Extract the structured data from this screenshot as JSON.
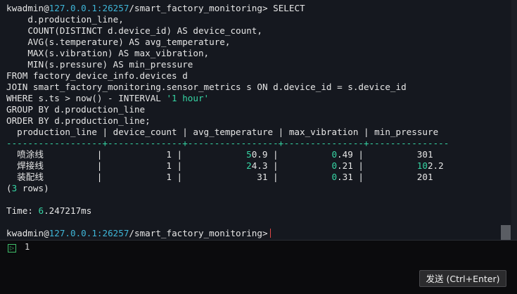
{
  "prompt": {
    "user": "kwadmin",
    "at": "@",
    "host": "127.0.0.1:26257",
    "db": "/smart_factory_monitoring",
    "symbol": ">"
  },
  "query_lines": [
    " SELECT",
    "    d.production_line,",
    "    COUNT(DISTINCT d.device_id) AS device_count,",
    "    AVG(s.temperature) AS avg_temperature,",
    "    MAX(s.vibration) AS max_vibration,",
    "    MIN(s.pressure) AS min_pressure",
    "FROM factory_device_info.devices d",
    "JOIN smart_factory_monitoring.sensor_metrics s ON d.device_id = s.device_id",
    "WHERE s.ts > now() - INTERVAL ",
    "GROUP BY d.production_line",
    "ORDER BY d.production_line;"
  ],
  "interval_literal": "'1 hour'",
  "result_table": {
    "header": "  production_line | device_count | avg_temperature | max_vibration | min_pressure",
    "separator": "------------------+--------------+-----------------+---------------+---------------",
    "rows": [
      {
        "name": "喷涂线",
        "device_count": "1",
        "avg_temperature_hl": "5",
        "avg_temperature_rest": "0.9",
        "max_vibration_hl": "0",
        "max_vibration_rest": ".49",
        "min_pressure": "301"
      },
      {
        "name": "焊接线",
        "device_count": "1",
        "avg_temperature_hl": "2",
        "avg_temperature_rest": "4.3",
        "max_vibration_hl": "0",
        "max_vibration_rest": ".21",
        "min_pressure_hl": "10",
        "min_pressure_rest": "2.2"
      },
      {
        "name": "装配线",
        "device_count": "1",
        "avg_temperature": "31",
        "max_vibration_hl": "0",
        "max_vibration_rest": ".31",
        "min_pressure": "201"
      }
    ]
  },
  "row_count": {
    "open": "(",
    "num": "3",
    "rest": " rows)"
  },
  "timing": {
    "label": "Time: ",
    "value": "6",
    "rest": ".247217ms"
  },
  "input_panel": {
    "line_number": "1",
    "icon": "line-number-icon"
  },
  "send_button_label": "发送 (Ctrl+Enter)"
}
